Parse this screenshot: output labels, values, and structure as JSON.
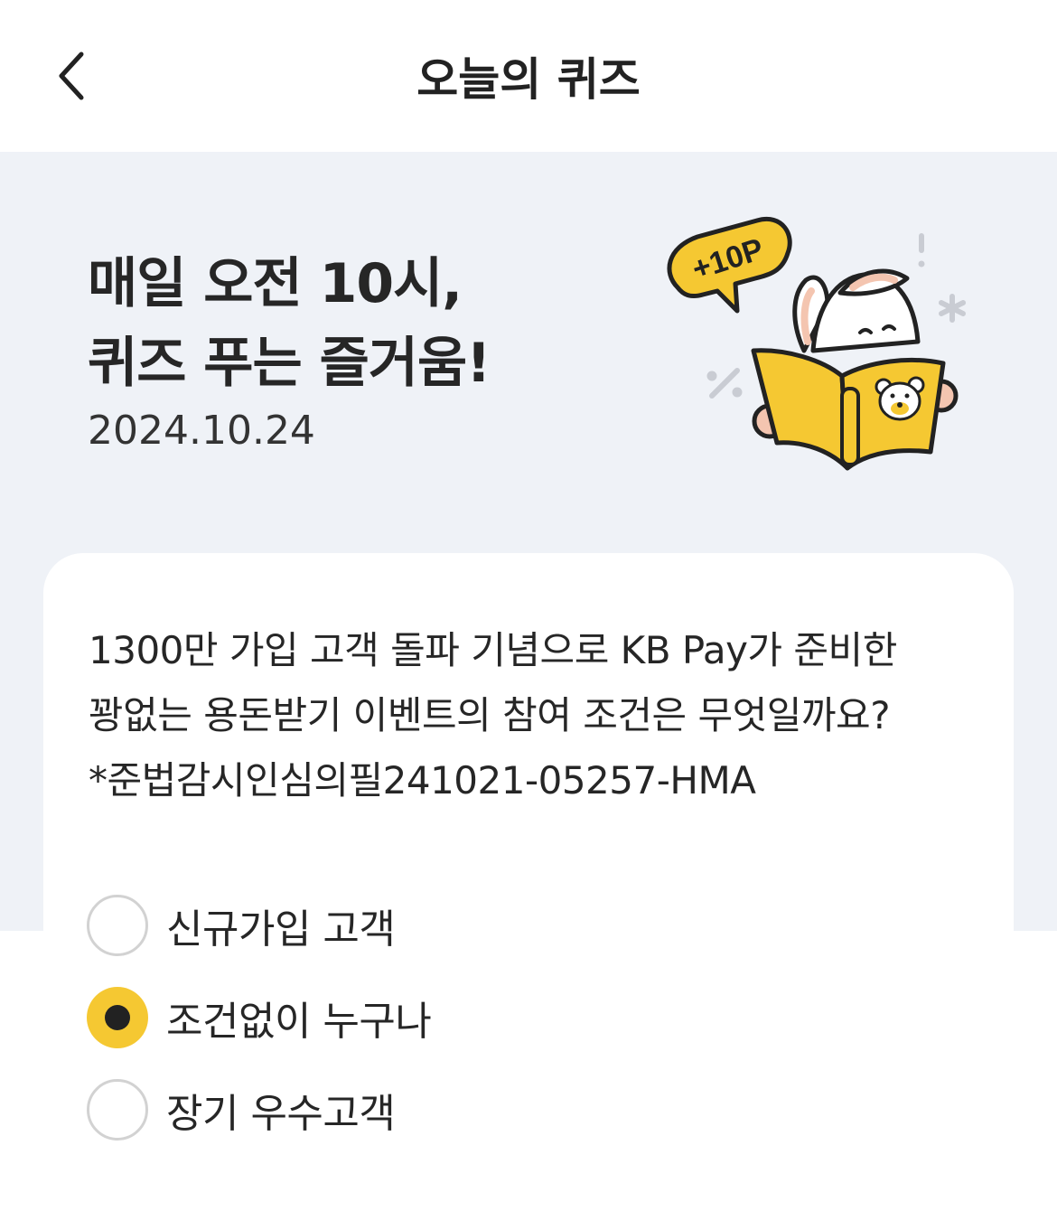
{
  "header": {
    "title": "오늘의 퀴즈",
    "back_icon": "chevron-left-icon"
  },
  "hero": {
    "title_line1": "매일 오전 10시,",
    "title_line2": "퀴즈 푸는 즐거움!",
    "date": "2024.10.24",
    "badge_text": "+10P"
  },
  "quiz": {
    "question_line1": "1300만 가입 고객 돌파 기념으로 KB Pay가 준비한",
    "question_line2": "꽝없는 용돈받기 이벤트의 참여 조건은 무엇일까요?",
    "question_line3": "*준법감시인심의필241021-05257-HMA",
    "options": [
      {
        "label": "신규가입 고객",
        "selected": false
      },
      {
        "label": "조건없이 누구나",
        "selected": true
      },
      {
        "label": "장기 우수고객",
        "selected": false
      }
    ]
  },
  "colors": {
    "accent": "#f5c832",
    "hero_bg": "#eff2f7",
    "text": "#262626",
    "radio_border": "#d2d2d2"
  }
}
